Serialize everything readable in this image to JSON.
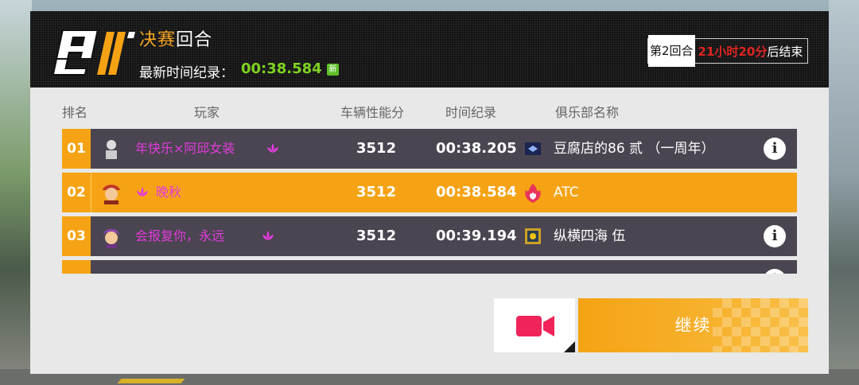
{
  "header": {
    "title_highlight": "决赛",
    "title_rest": "回合",
    "record_label": "最新时间纪录：",
    "record_value": "00:38.584",
    "new_badge": "新",
    "round_prefix": "第2回合",
    "round_hours": "21",
    "round_hour_unit": "小时",
    "round_minutes": "20",
    "round_minute_unit": "分",
    "round_suffix": "后结束"
  },
  "columns": {
    "rank": "排名",
    "player": "玩家",
    "performance": "车辆性能分",
    "time": "时间纪录",
    "club": "俱乐部名称"
  },
  "rows": [
    {
      "rank": "01",
      "name": "年快乐×阿邱女装",
      "score": "3512",
      "time": "00:38.205",
      "club": "豆腐店的86  贰 （一周年）"
    },
    {
      "rank": "02",
      "name": "晚秋",
      "score": "3512",
      "time": "00:38.584",
      "club": "ATC"
    },
    {
      "rank": "03",
      "name": "会报复你，永远",
      "score": "3512",
      "time": "00:39.194",
      "club": "纵横四海 伍"
    }
  ],
  "buttons": {
    "continue": "继续"
  },
  "colors": {
    "accent": "#f5a314",
    "record_green": "#7ed321",
    "player_name": "#e23bdc",
    "row_dark": "#4a4550",
    "countdown_red": "#e02424",
    "video_icon": "#f0245a"
  }
}
